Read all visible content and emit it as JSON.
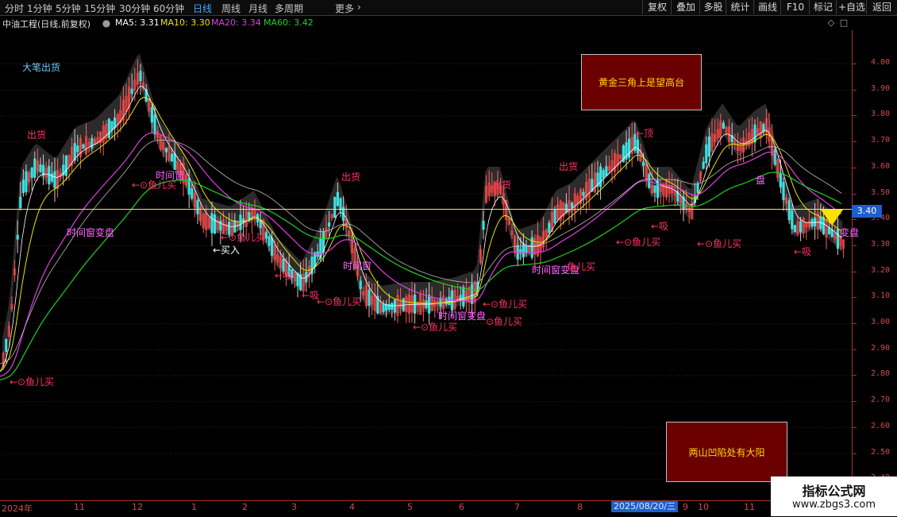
{
  "toolbar": {
    "timeframes": [
      {
        "label": "分时",
        "active": false
      },
      {
        "label": "1分钟",
        "active": false
      },
      {
        "label": "5分钟",
        "active": false
      },
      {
        "label": "15分钟",
        "active": false
      },
      {
        "label": "30分钟",
        "active": false
      },
      {
        "label": "60分钟",
        "active": false
      },
      {
        "label": "日线",
        "active": true
      },
      {
        "label": "周线",
        "active": false
      },
      {
        "label": "月线",
        "active": false
      },
      {
        "label": "多周期",
        "active": false
      },
      {
        "label": "更多",
        "active": false
      }
    ],
    "more_arrow": "›",
    "right_buttons": [
      "复权",
      "叠加",
      "多股",
      "统计",
      "画线",
      "F10",
      "标记",
      "+自选",
      "返回"
    ]
  },
  "info": {
    "title": "中油工程(日线,前复权)",
    "ma5": "MA5: 3.31",
    "ma10": "MA10: 3.30",
    "ma20": "MA20: 3.34",
    "ma60": "MA60: 3.42",
    "colors": {
      "ma5": "#ffffff",
      "ma10": "#e6e600",
      "ma20": "#e040e0",
      "ma60": "#20d020"
    }
  },
  "icons": [
    "settings-dot-icon",
    "diamond-icon",
    "square-icon"
  ],
  "y_axis": {
    "ticks": [
      "4.00",
      "3.90",
      "3.80",
      "3.70",
      "3.60",
      "3.50",
      "3.40",
      "3.30",
      "3.20",
      "3.10",
      "3.00",
      "2.90",
      "2.80",
      "2.70",
      "2.60",
      "2.50",
      "2.40"
    ],
    "current_price": "3.40"
  },
  "x_axis": {
    "labels": [
      "2024年",
      "11",
      "12",
      "1",
      "2",
      "3",
      "4",
      "5",
      "6",
      "7",
      "8",
      "9",
      "10",
      "11"
    ],
    "cursor_date": "2025/08/20/三"
  },
  "signals": [
    {
      "text": "大笔出货",
      "color": "#66ccff"
    },
    {
      "text": "出货",
      "color": "#ff3366"
    },
    {
      "text": "出货",
      "color": "#ff3366"
    },
    {
      "text": "出货",
      "color": "#ff3366"
    },
    {
      "text": "出货",
      "color": "#ff3366"
    },
    {
      "text": "←顶",
      "color": "#ff3366"
    },
    {
      "text": "←⊙鱼儿买",
      "color": "#ff3366"
    },
    {
      "text": "←⊙鱼儿买",
      "color": "#ff3366"
    },
    {
      "text": "←⊙鱼儿买",
      "color": "#ff3366"
    },
    {
      "text": "←⊙鱼儿买",
      "color": "#ff3366"
    },
    {
      "text": "←⊙鱼儿买",
      "color": "#ff3366"
    },
    {
      "text": "⊙鱼儿买",
      "color": "#ff3366"
    },
    {
      "text": "←⊙鱼儿买",
      "color": "#ff3366"
    },
    {
      "text": "←⊙鱼儿买",
      "color": "#ff3366"
    },
    {
      "text": "←⊙鱼儿买",
      "color": "#ff3366"
    },
    {
      "text": "←吸",
      "color": "#ff3366"
    },
    {
      "text": "←吸",
      "color": "#ff3366"
    },
    {
      "text": "←吸",
      "color": "#ff3366"
    },
    {
      "text": "←吸",
      "color": "#ff3366"
    },
    {
      "text": "←买入",
      "color": "#ffffff"
    },
    {
      "text": "时间窗变盘",
      "color": "#ff66ff"
    },
    {
      "text": "时间窗",
      "color": "#ff66ff"
    },
    {
      "text": "时间窗变盘",
      "color": "#ff66ff"
    },
    {
      "text": "时间窗变盘",
      "color": "#ff66ff"
    },
    {
      "text": "时间窗",
      "color": "#ff66ff"
    },
    {
      "text": "鱼儿买",
      "color": "#ff3366"
    },
    {
      "text": "盘",
      "color": "#ff66ff"
    },
    {
      "text": "变盘",
      "color": "#ff66ff"
    }
  ],
  "boxes": {
    "top": "黄金三角上是望高台",
    "bottom": "两山凹陷处有大阳"
  },
  "brand": {
    "line1": "指标公式网",
    "line2": "www.zbgs3.com"
  }
}
